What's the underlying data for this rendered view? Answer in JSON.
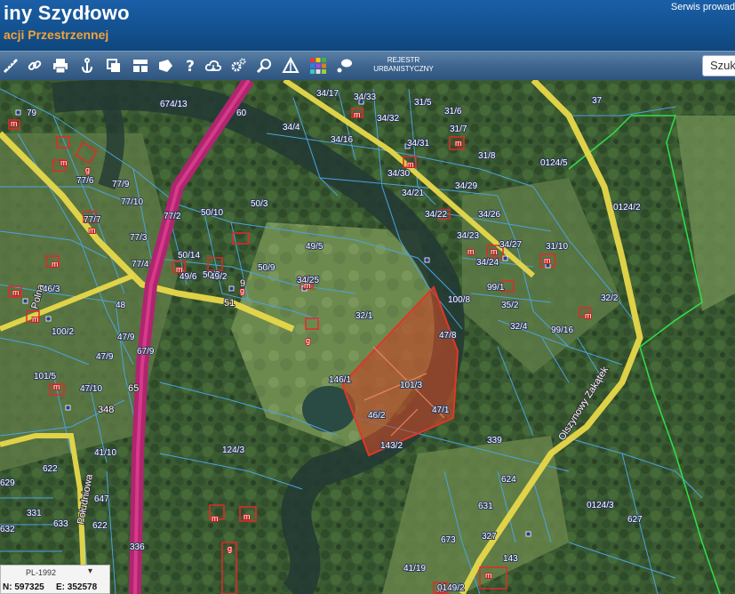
{
  "header": {
    "title": "iny Szydłowo",
    "subtitle": "acji Przestrzennej",
    "service_link": "Serwis prowad"
  },
  "toolbar": {
    "tools": [
      "ruler-icon",
      "link-icon",
      "print-icon",
      "anchor-icon",
      "copy-icon",
      "layout-icon",
      "shape-icon",
      "help-icon",
      "cloud-icon",
      "settings-icon",
      "zoom-icon",
      "triangle-icon",
      "palette-icon",
      "comment-icon"
    ],
    "registry_line1": "REJESTR",
    "registry_line2": "URBANISTYCZNY",
    "search_placeholder": "Szuk"
  },
  "colors": {
    "road_yellow": "#e8d84a",
    "road_magenta": "#b0256f",
    "parcel_line": "#4aa3e0",
    "highlight_fill": "#c0492a",
    "highlight_stroke": "#e0362a",
    "boundary_green": "#2ee04a",
    "building_red": "#e02a2a"
  },
  "map": {
    "parcels": [
      "674/13",
      "60",
      "34/17",
      "34/33",
      "31/5",
      "31/6",
      "37",
      "79",
      "34/4",
      "34/32",
      "31/7",
      "34/16",
      "34/31",
      "31/8",
      "0124/5",
      "77/6",
      "34/30",
      "77/9",
      "34/21",
      "34/29",
      "0124/2",
      "77/10",
      "50/10",
      "50/3",
      "77/2",
      "34/22",
      "34/26",
      "77/7",
      "34/23",
      "34/27",
      "31/10",
      "77/3",
      "49/5",
      "77/4",
      "50/14",
      "34/24",
      "50/8",
      "49/6",
      "50/9",
      "49/2",
      "34/25",
      "99/1",
      "46/3",
      "100/8",
      "48",
      "32/1",
      "35/2",
      "32/2",
      "32/4",
      "99/16",
      "100/2",
      "47/9",
      "47/8",
      "146/1",
      "67/9",
      "47/9",
      "101/3",
      "101/5",
      "47/10",
      "46/2",
      "47/1",
      "143/2",
      "124/3",
      "339",
      "624",
      "41/10",
      "0124/3",
      "627",
      "622",
      "647",
      "629",
      "331",
      "631",
      "633",
      "622",
      "327",
      "632",
      "673",
      "41/19",
      "143",
      "336",
      "0149/2"
    ],
    "roads": [
      "51",
      "65",
      "348",
      "Polna",
      "Południowa",
      "Olszynowy Zakątek",
      "9"
    ],
    "building_marks": [
      "m",
      "g"
    ]
  },
  "coordinates": {
    "crs": "PL-1992",
    "n_label": "N: 597325",
    "e_label": "E: 352578"
  }
}
